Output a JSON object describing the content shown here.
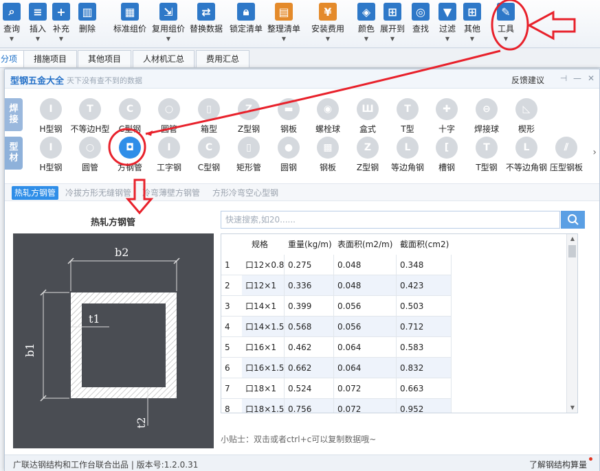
{
  "toolbar": {
    "items": [
      {
        "label": "查询",
        "icon": "magnifier-icon",
        "arrow": true
      },
      {
        "label": "插入",
        "icon": "insert-list-icon",
        "arrow": true
      },
      {
        "label": "补充",
        "icon": "add-doc-icon",
        "arrow": true
      },
      {
        "label": "删除",
        "icon": "trash-icon",
        "arrow": false
      },
      {
        "label": "标准组价",
        "icon": "grid-icon",
        "arrow": false
      },
      {
        "label": "复用组价",
        "icon": "reuse-icon",
        "arrow": true
      },
      {
        "label": "替换数据",
        "icon": "replace-icon",
        "arrow": false
      },
      {
        "label": "锁定清单",
        "icon": "lock-icon",
        "arrow": false
      },
      {
        "label": "整理清单",
        "icon": "organize-icon",
        "arrow": true
      },
      {
        "label": "安装费用",
        "icon": "install-fee-icon",
        "arrow": true
      },
      {
        "label": "颜色",
        "icon": "paint-bucket-icon",
        "arrow": true
      },
      {
        "label": "展开到",
        "icon": "expand-tree-icon",
        "arrow": true
      },
      {
        "label": "查找",
        "icon": "binoculars-icon",
        "arrow": false
      },
      {
        "label": "过滤",
        "icon": "filter-icon",
        "arrow": true
      },
      {
        "label": "其他",
        "icon": "apps-grid-icon",
        "arrow": true
      },
      {
        "label": "工具",
        "icon": "tools-icon",
        "arrow": true
      }
    ]
  },
  "tabs": [
    {
      "label": "分项"
    },
    {
      "label": "措施项目"
    },
    {
      "label": "其他项目"
    },
    {
      "label": "人材机汇总"
    },
    {
      "label": "费用汇总"
    }
  ],
  "dialog": {
    "title": "型钢五金大全",
    "subtitle": "天下没有查不到的数据",
    "feedback": "反馈建议",
    "categories": [
      {
        "label_top": "焊",
        "label_bottom": "接"
      },
      {
        "label_top": "型",
        "label_bottom": "材"
      }
    ],
    "weld_shapes": [
      "H型钢",
      "不等边H型",
      "C型钢",
      "圆管",
      "箱型",
      "Z型钢",
      "钢板",
      "螺栓球",
      "盒式",
      "T型",
      "十字",
      "焊接球",
      "楔形"
    ],
    "profile_shapes": [
      "H型钢",
      "圆管",
      "方钢管",
      "工字钢",
      "C型钢",
      "矩形管",
      "圆钢",
      "钢板",
      "Z型钢",
      "等边角钢",
      "槽钢",
      "T型钢",
      "不等边角钢",
      "压型钢板"
    ],
    "subtabs": [
      "热轧方钢管",
      "冷拔方形无缝钢管",
      "冷弯薄壁方钢管",
      "方形冷弯空心型钢"
    ],
    "diagram": {
      "title": "热轧方钢管",
      "label_b2": "b2",
      "label_b1": "b1",
      "label_t1": "t1",
      "label_t2": "t2"
    },
    "search": {
      "placeholder": "快速搜索,如20......"
    },
    "table": {
      "headers": [
        "规格",
        "重量(kg/m)",
        "表面积(m2/m)",
        "截面积(cm2)"
      ],
      "rows": [
        {
          "idx": "1",
          "spec": "口12×0.8",
          "weight": "0.275",
          "surface": "0.048",
          "section": "0.348"
        },
        {
          "idx": "2",
          "spec": "口12×1",
          "weight": "0.336",
          "surface": "0.048",
          "section": "0.423"
        },
        {
          "idx": "3",
          "spec": "口14×1",
          "weight": "0.399",
          "surface": "0.056",
          "section": "0.503"
        },
        {
          "idx": "4",
          "spec": "口14×1.5",
          "weight": "0.568",
          "surface": "0.056",
          "section": "0.712"
        },
        {
          "idx": "5",
          "spec": "口16×1",
          "weight": "0.462",
          "surface": "0.064",
          "section": "0.583"
        },
        {
          "idx": "6",
          "spec": "口16×1.5",
          "weight": "0.662",
          "surface": "0.064",
          "section": "0.832"
        },
        {
          "idx": "7",
          "spec": "口18×1",
          "weight": "0.524",
          "surface": "0.072",
          "section": "0.663"
        },
        {
          "idx": "8",
          "spec": "口18×1.5",
          "weight": "0.756",
          "surface": "0.072",
          "section": "0.952"
        }
      ]
    },
    "tip": "小贴士：双击或者ctrl+c可以复制数据哦~",
    "footer_left": "广联达钢结构和工作台联合出品 | 版本号:1.2.0.31",
    "footer_right": "了解钢结构算量"
  },
  "colors": {
    "accent": "#2f8ee8",
    "annotation": "#e8212b"
  }
}
